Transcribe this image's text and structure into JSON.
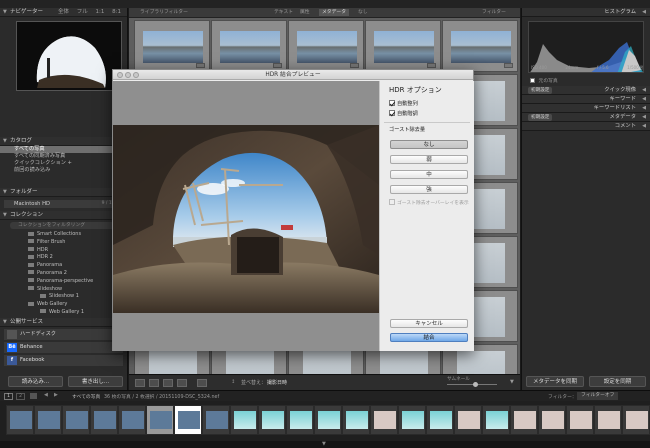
{
  "top": {
    "navigator_title": "ナビゲーター",
    "navigator_tabs": [
      "全体",
      "フル",
      "1:1",
      "8:1"
    ],
    "grid_label": "ライブラリフィルター",
    "grid_filters": [
      "テキスト",
      "属性",
      "メタデータ",
      "なし"
    ],
    "grid_filter_right": "フィルター",
    "histogram_title": "ヒストグラム"
  },
  "left": {
    "catalog_title": "カタログ",
    "catalog_items": [
      {
        "label": "すべての写真",
        "count": ""
      },
      {
        "label": "すべての同期済み写真",
        "count": ""
      },
      {
        "label": "クイックコレクション +",
        "count": ""
      },
      {
        "label": "前回の読み込み",
        "count": ""
      }
    ],
    "folders_title": "フォルダー",
    "folder_name": "Macintosh HD",
    "folder_count": "9 / 1 TB",
    "collections_title": "コレクション",
    "collection_filter": "コレクションをフィルタリング",
    "collections": [
      {
        "label": "Smart Collections",
        "indent": 1
      },
      {
        "label": "Filter Brush",
        "indent": 1
      },
      {
        "label": "HDR",
        "indent": 1
      },
      {
        "label": "HDR 2",
        "indent": 1
      },
      {
        "label": "Panorama",
        "indent": 1
      },
      {
        "label": "Panorama 2",
        "indent": 1
      },
      {
        "label": "Panorama-perspective",
        "indent": 1
      },
      {
        "label": "Slideshow",
        "indent": 1
      },
      {
        "label": "Slideshow 1",
        "indent": 2
      },
      {
        "label": "Web Gallery",
        "indent": 1
      },
      {
        "label": "Web Gallery 1",
        "indent": 2
      }
    ],
    "publish_title": "公開サービス",
    "services": [
      {
        "label": "ハードディスク",
        "logo": ""
      },
      {
        "label": "Behance",
        "logo": "Bē"
      },
      {
        "label": "Facebook",
        "logo": "f"
      }
    ],
    "import_button": "読み込み...",
    "export_button": "書き出し..."
  },
  "right": {
    "histogram_info": [
      "ISO 400",
      "24mm",
      "f / 5.6",
      "1/500 秒"
    ],
    "original_photo": "元の写真",
    "quick_develop_select": "初期設定",
    "quick_develop": "クイック現像",
    "keywords": "キーワード",
    "keyword_list": "キーワードリスト",
    "metadata_select": "初期設定",
    "metadata": "メタデータ",
    "comments": "コメント",
    "sync_metadata_button": "メタデータを同期",
    "sync_settings_button": "設定を同期"
  },
  "toolbar": {
    "sort_label": "並べ替え：",
    "sort_value": "撮影日時",
    "thumb_label": "サムネール"
  },
  "filmbar": {
    "page_numbers": [
      "1",
      "2"
    ],
    "source": "すべての写真",
    "info": "36 枚の写真 / 2 枚選択 / 20151109-DSC_5324.nef",
    "filter_label": "フィルター：",
    "filter_value": "フィルターオフ"
  },
  "dialog": {
    "title": "HDR 結合プレビュー",
    "options_title": "HDR オプション",
    "auto_align": "自動整列",
    "auto_tone": "自動階調",
    "deghost_title": "ゴースト除去量",
    "deghost_levels": [
      "なし",
      "弱",
      "中",
      "強"
    ],
    "deghost_selected": 0,
    "show_overlay": "ゴースト除去オーバーレイを表示",
    "cancel_button": "キャンセル",
    "merge_button": "結合"
  },
  "colors": {
    "default_button": "#6fa8e8",
    "panel_bg": "#2b2b2b",
    "grid_bg": "#5e5e5e",
    "dialog_bg": "#ececec"
  }
}
